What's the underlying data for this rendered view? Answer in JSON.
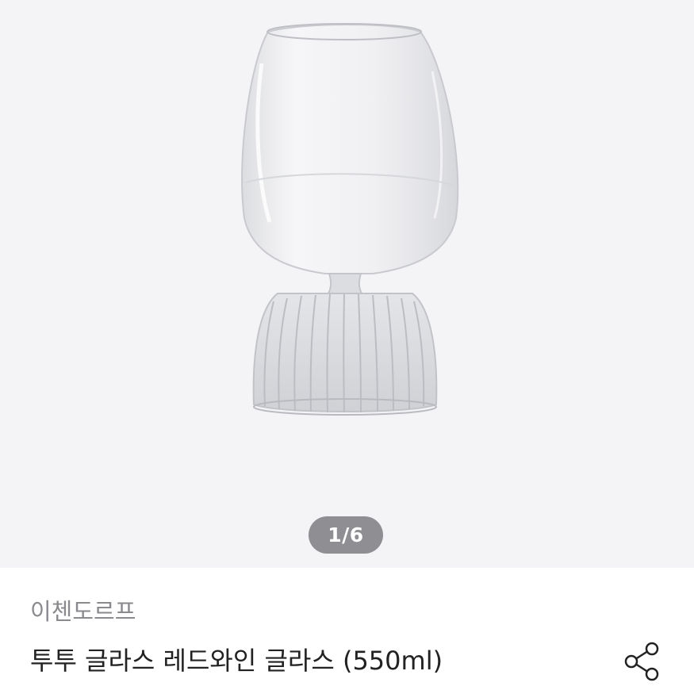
{
  "gallery": {
    "image_label": "product-photo",
    "current_page": "1/6"
  },
  "product": {
    "brand": "이첸도르프",
    "title": "투투 글라스 레드와인 글라스 (550ml)"
  },
  "icons": {
    "share": "share-icon"
  },
  "colors": {
    "gallery_bg": "#f4f4f6",
    "indicator_bg": "#8e8e93",
    "brand_text": "#8a8a8e",
    "title_text": "#222222",
    "rating_accent": "#8fd3f1"
  }
}
